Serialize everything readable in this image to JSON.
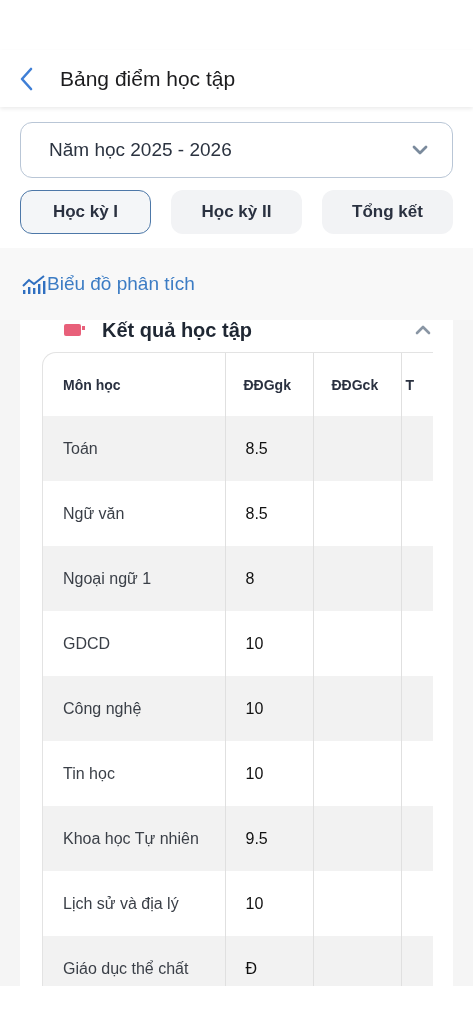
{
  "header": {
    "title": "Bảng điểm học tập"
  },
  "year_select": {
    "value": "Năm học 2025 - 2026"
  },
  "tabs": [
    {
      "label": "Học kỳ I",
      "selected": true
    },
    {
      "label": "Học kỳ II",
      "selected": false
    },
    {
      "label": "Tổng kết",
      "selected": false
    }
  ],
  "chart_link": {
    "label": "Biểu đồ phân tích"
  },
  "results_card": {
    "title": "Kết quả học tập",
    "expanded": true,
    "table": {
      "columns": [
        "Môn học",
        "ĐĐGgk",
        "ĐĐGck",
        "T"
      ],
      "rows": [
        [
          "Toán",
          "8.5"
        ],
        [
          "Ngữ văn",
          "8.5"
        ],
        [
          "Ngoại ngữ 1",
          "8"
        ],
        [
          "GDCD",
          "10"
        ],
        [
          "Công nghệ",
          "10"
        ],
        [
          "Tin học",
          "10"
        ],
        [
          "Khoa học Tự nhiên",
          "9.5"
        ],
        [
          "Lịch sử và địa lý",
          "10"
        ],
        [
          "Giáo dục thể chất",
          "Đ"
        ]
      ]
    }
  }
}
